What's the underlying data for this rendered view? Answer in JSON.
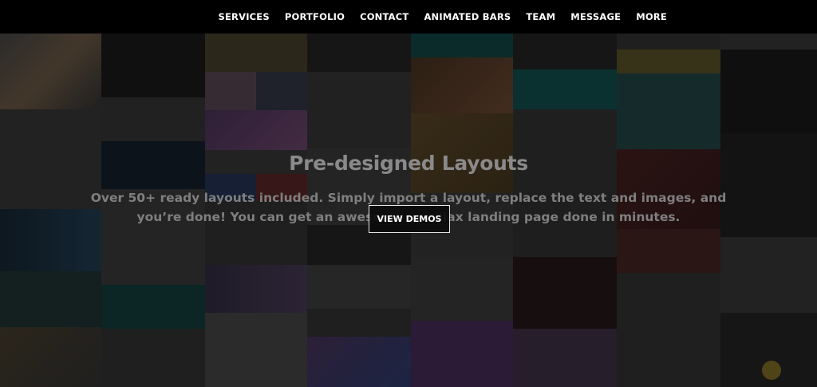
{
  "nav": {
    "items": [
      "SERVICES",
      "PORTFOLIO",
      "CONTACT",
      "ANIMATED BARS",
      "TEAM",
      "MESSAGE",
      "MORE"
    ]
  },
  "hero": {
    "title": "Pre-designed Layouts",
    "description": "Over 50+ ready layouts included. Simply import a layout, replace the text and images, and you’re done! You can get an awesome parallax landing page done in minutes.",
    "button_label": "VIEW DEMOS"
  },
  "colors": {
    "nav_background": "#000000",
    "nav_text": "#ffffff",
    "page_background": "#0b0b0b",
    "hero_text": "#8a8a8a",
    "button_border": "#e8e8e8"
  }
}
